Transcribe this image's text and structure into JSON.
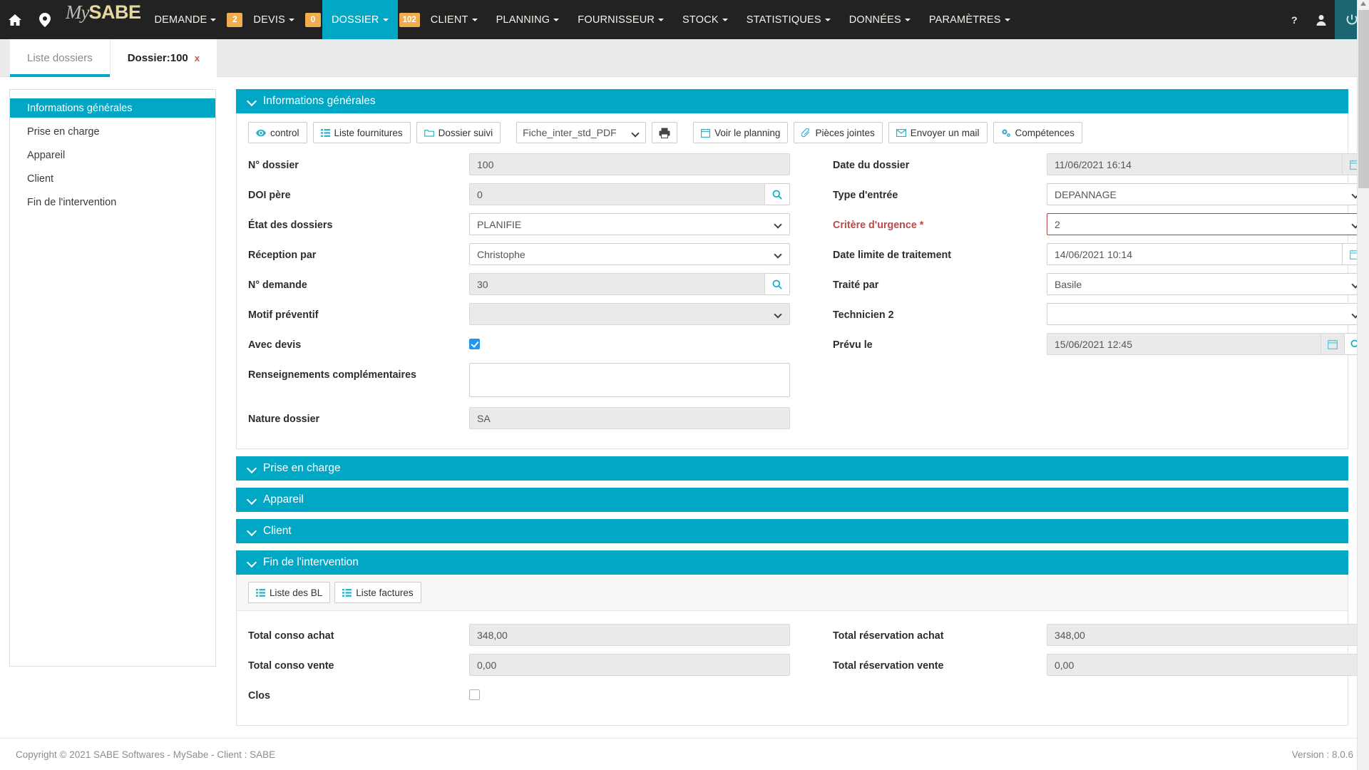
{
  "navbar": {
    "home_icon": "home-icon",
    "location_icon": "location-pin-icon",
    "brand_my": "My",
    "brand_sabe": "SABE",
    "items": [
      {
        "label": "DEMANDE",
        "caret": true,
        "badge": "2"
      },
      {
        "label": "DEVIS",
        "caret": true,
        "badge": "0"
      },
      {
        "label": "DOSSIER",
        "caret": true,
        "badge": "102",
        "active": true
      },
      {
        "label": "CLIENT",
        "caret": true
      },
      {
        "label": "PLANNING",
        "caret": true
      },
      {
        "label": "FOURNISSEUR",
        "caret": true
      },
      {
        "label": "STOCK",
        "caret": true
      },
      {
        "label": "STATISTIQUES",
        "caret": true
      },
      {
        "label": "DONNÉES",
        "caret": true
      },
      {
        "label": "PARAMÈTRES",
        "caret": true
      }
    ],
    "right": {
      "help_icon": "question-mark-icon",
      "user_icon": "user-icon",
      "power_icon": "power-icon"
    },
    "accent": "#00a8c6",
    "badge_color": "#f0ad4e",
    "background": "#222222"
  },
  "tabs": [
    {
      "label": "Liste dossiers",
      "closable": false
    },
    {
      "label": "Dossier:100",
      "closable": true,
      "close_label": "x",
      "current": true
    }
  ],
  "sidebar": {
    "items": [
      {
        "label": "Informations générales",
        "active": true
      },
      {
        "label": "Prise en charge",
        "active": false
      },
      {
        "label": "Appareil",
        "active": false
      },
      {
        "label": "Client",
        "active": false
      },
      {
        "label": "Fin de l'intervention",
        "active": false
      }
    ]
  },
  "panels": {
    "infos": {
      "title": "Informations générales",
      "toolbar": [
        {
          "label": "control",
          "icon": "eye-icon"
        },
        {
          "label": "Liste fournitures",
          "icon": "list-icon"
        },
        {
          "label": "Dossier suivi",
          "icon": "folder-icon"
        }
      ],
      "report_select": "Fiche_inter_std_PDF",
      "print_icon": "printer-icon",
      "toolbar_right": [
        {
          "label": "Voir le planning",
          "icon": "calendar-icon"
        },
        {
          "label": "Pièces jointes",
          "icon": "paperclip-icon"
        },
        {
          "label": "Envoyer un mail",
          "icon": "envelope-icon"
        },
        {
          "label": "Compétences",
          "icon": "gears-icon"
        }
      ],
      "left_fields": [
        {
          "label": "N° dossier",
          "value": "100",
          "type": "text",
          "readonly": true
        },
        {
          "label": "DOI père",
          "value": "0",
          "type": "search",
          "readonly": true,
          "addon_icon": "search-icon"
        },
        {
          "label": "État des dossiers",
          "value": "PLANIFIE",
          "type": "select",
          "readonly": false
        },
        {
          "label": "Réception par",
          "value": "Christophe",
          "type": "select",
          "readonly": false
        },
        {
          "label": "N° demande",
          "value": "30",
          "type": "search",
          "readonly": true,
          "addon_icon": "search-icon"
        },
        {
          "label": "Motif préventif",
          "value": "",
          "type": "select",
          "readonly": true
        },
        {
          "label": "Avec devis",
          "value": "",
          "type": "checkbox",
          "checked": true
        },
        {
          "label": "Renseignements complémentaires",
          "value": "",
          "type": "textarea"
        },
        {
          "label": "Nature dossier",
          "value": "SA",
          "type": "text",
          "readonly": true
        }
      ],
      "right_fields": [
        {
          "label": "Date du dossier",
          "value": "11/06/2021 16:14",
          "type": "date",
          "readonly": true,
          "addon_icon": "calendar-icon"
        },
        {
          "label": "Type d'entrée",
          "value": "DEPANNAGE",
          "type": "select",
          "readonly": false
        },
        {
          "label": "Critère d'urgence *",
          "value": "2",
          "type": "select",
          "readonly": false,
          "required": true
        },
        {
          "label": "Date limite de traitement",
          "value": "14/06/2021 10:14",
          "type": "date",
          "readonly": false,
          "addon_icon": "calendar-icon"
        },
        {
          "label": "Traité par",
          "value": "Basile",
          "type": "select",
          "readonly": false
        },
        {
          "label": "Technicien 2",
          "value": "",
          "type": "select",
          "readonly": false
        },
        {
          "label": "Prévu le",
          "value": "15/06/2021 12:45",
          "type": "date-search",
          "readonly": true,
          "addon_icon": "calendar-icon",
          "addon2_icon": "search-icon"
        }
      ]
    },
    "collapsed": [
      {
        "title": "Prise en charge"
      },
      {
        "title": "Appareil"
      },
      {
        "title": "Client"
      }
    ],
    "fin": {
      "title": "Fin de l'intervention",
      "toolbar": [
        {
          "label": "Liste des BL",
          "icon": "list-icon"
        },
        {
          "label": "Liste factures",
          "icon": "list-icon"
        }
      ],
      "left_fields": [
        {
          "label": "Total conso achat",
          "value": "348,00",
          "type": "text",
          "readonly": true
        },
        {
          "label": "Total conso vente",
          "value": "0,00",
          "type": "text",
          "readonly": true
        },
        {
          "label": "Clos",
          "value": "",
          "type": "checkbox",
          "checked": false
        }
      ],
      "right_fields": [
        {
          "label": "Total réservation achat",
          "value": "348,00",
          "type": "text",
          "readonly": true
        },
        {
          "label": "Total réservation vente",
          "value": "0,00",
          "type": "text",
          "readonly": true
        }
      ]
    }
  },
  "footer": {
    "copyright": "Copyright © 2021 SABE Softwares - MySabe - Client : SABE",
    "version": "Version : 8.0.6"
  }
}
